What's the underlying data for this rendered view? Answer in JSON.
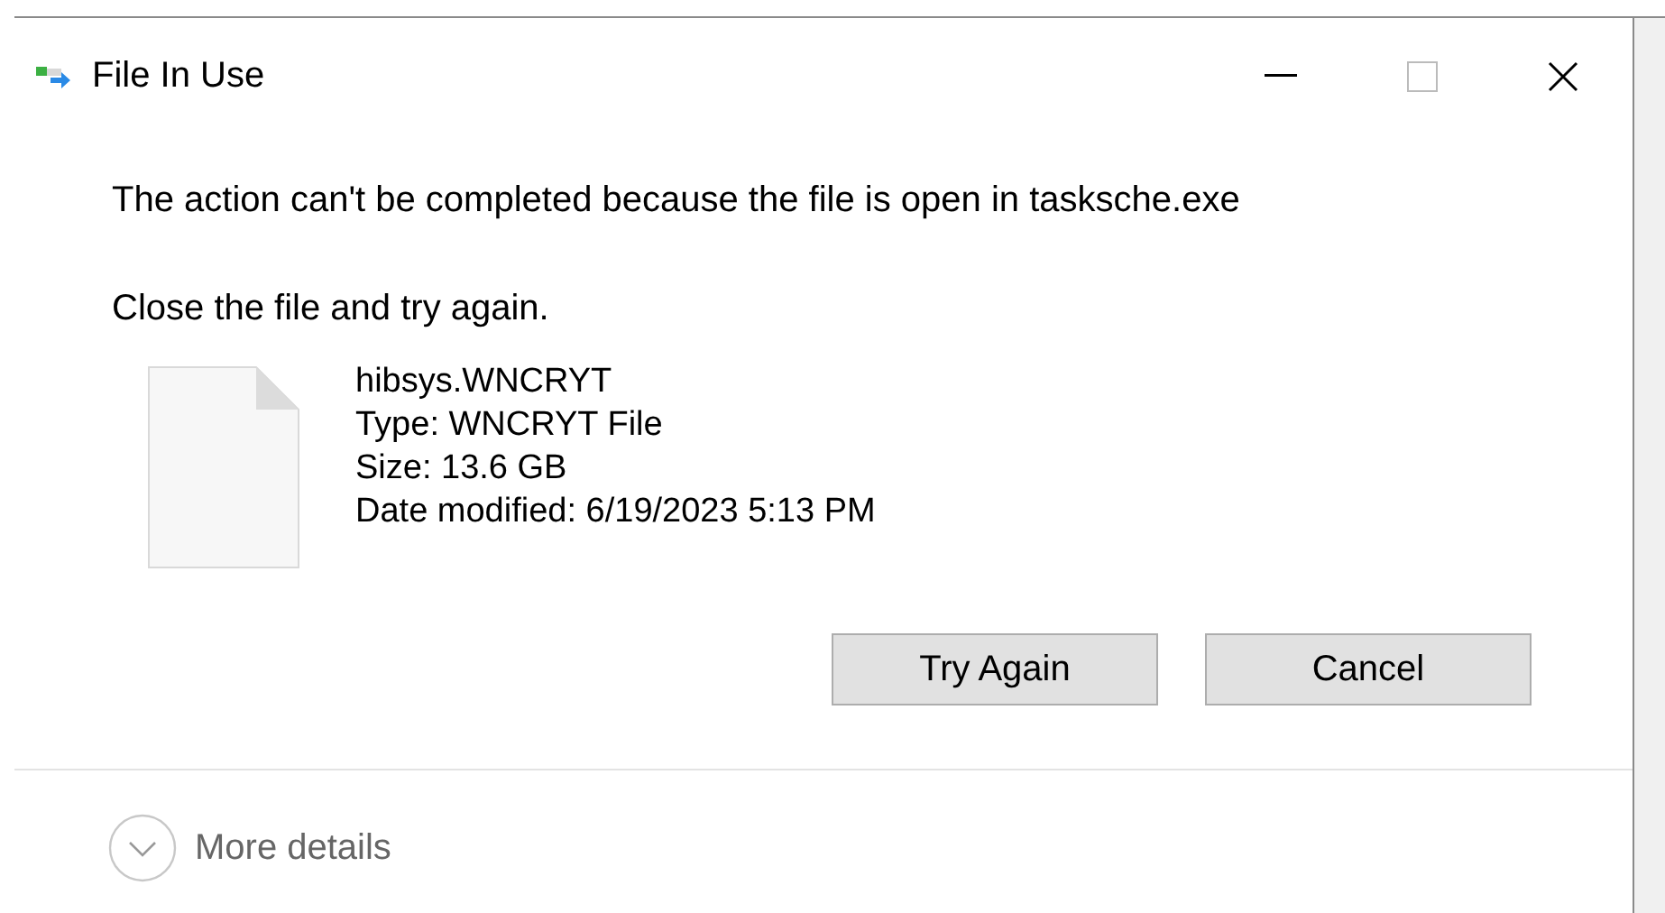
{
  "window": {
    "title": "File In Use"
  },
  "message": "The action can't be completed because the file is open in tasksche.exe",
  "instruction": "Close the file and try again.",
  "file": {
    "name": "hibsys.WNCRYT",
    "details": [
      "Type: WNCRYT File",
      "Size: 13.6 GB",
      "Date modified: 6/19/2023 5:13 PM"
    ]
  },
  "buttons": [
    "Try Again",
    "Cancel"
  ],
  "more_details": {
    "label": "More details",
    "expanded": false
  }
}
